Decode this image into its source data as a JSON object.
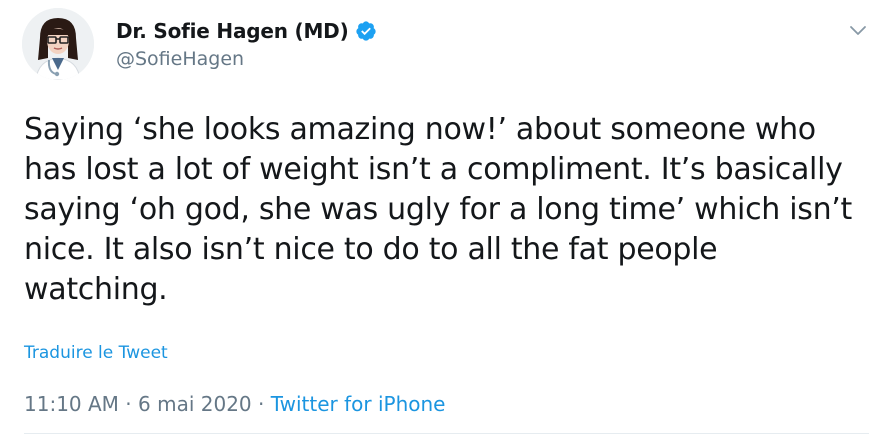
{
  "author": {
    "display_name": "Dr. Sofie Hagen (MD)",
    "handle": "@SofieHagen",
    "verified_icon": "verified-badge-icon",
    "avatar_icon": "profile-avatar"
  },
  "tweet": {
    "text": "Saying ‘she looks amazing now!’ about someone who\nhas lost a lot of weight isn’t a compliment. It’s basically\nsaying ‘oh god, she was ugly for a long time’ which isn’t\nnice. It also isn’t nice to do to all the fat people\nwatching.",
    "translate_label": "Traduire le Tweet",
    "time": "11:10 AM",
    "separator": " · ",
    "date": "6 mai 2020",
    "source": "Twitter for iPhone"
  },
  "menu": {
    "caret_icon": "chevron-down-icon"
  },
  "colors": {
    "text": "#14171a",
    "secondary": "#657786",
    "accent": "#1b95e0",
    "verified": "#1da1f2"
  }
}
